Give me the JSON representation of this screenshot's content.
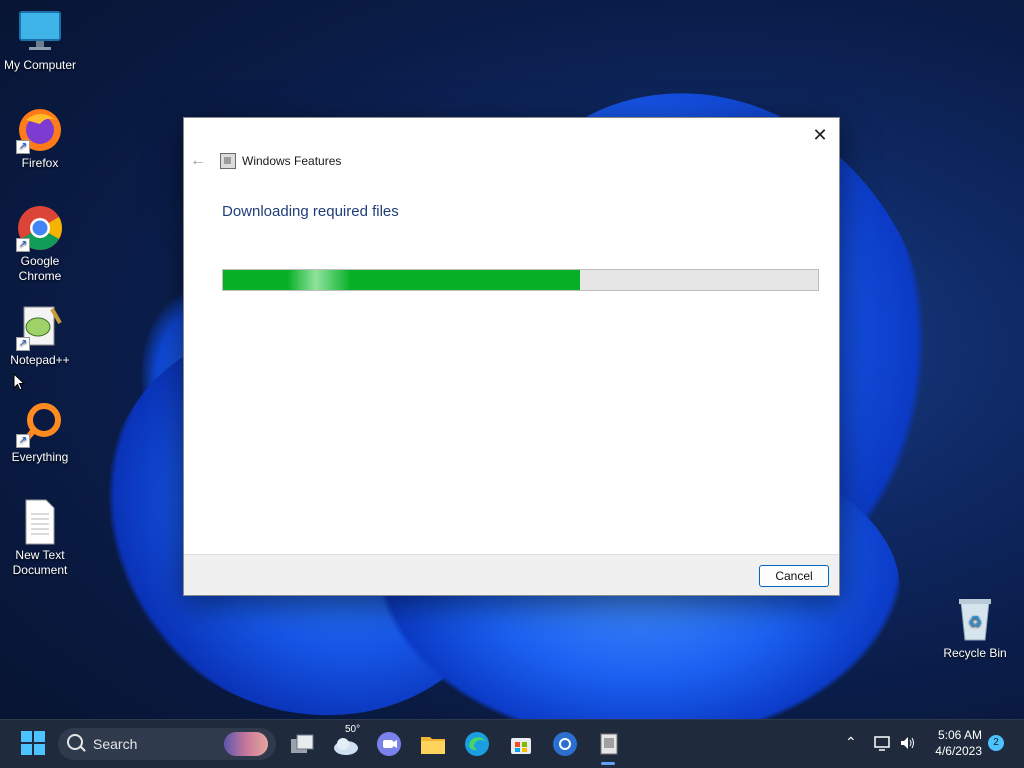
{
  "desktop": {
    "icons": [
      {
        "label": "My Computer"
      },
      {
        "label": "Firefox"
      },
      {
        "label": "Google Chrome"
      },
      {
        "label": "Notepad++"
      },
      {
        "label": "Everything"
      },
      {
        "label": "New Text Document"
      },
      {
        "label": "Recycle Bin"
      }
    ]
  },
  "dialog": {
    "title": "Windows Features",
    "heading": "Downloading required files",
    "progress_percent": 60,
    "cancel_label": "Cancel"
  },
  "taskbar": {
    "search_label": "Search",
    "weather_temp": "50°",
    "time": "5:06 AM",
    "date": "4/6/2023",
    "notification_count": "2"
  },
  "colors": {
    "accent": "#0067c0",
    "progress_green": "#06b025",
    "heading_blue": "#1f3e79"
  }
}
